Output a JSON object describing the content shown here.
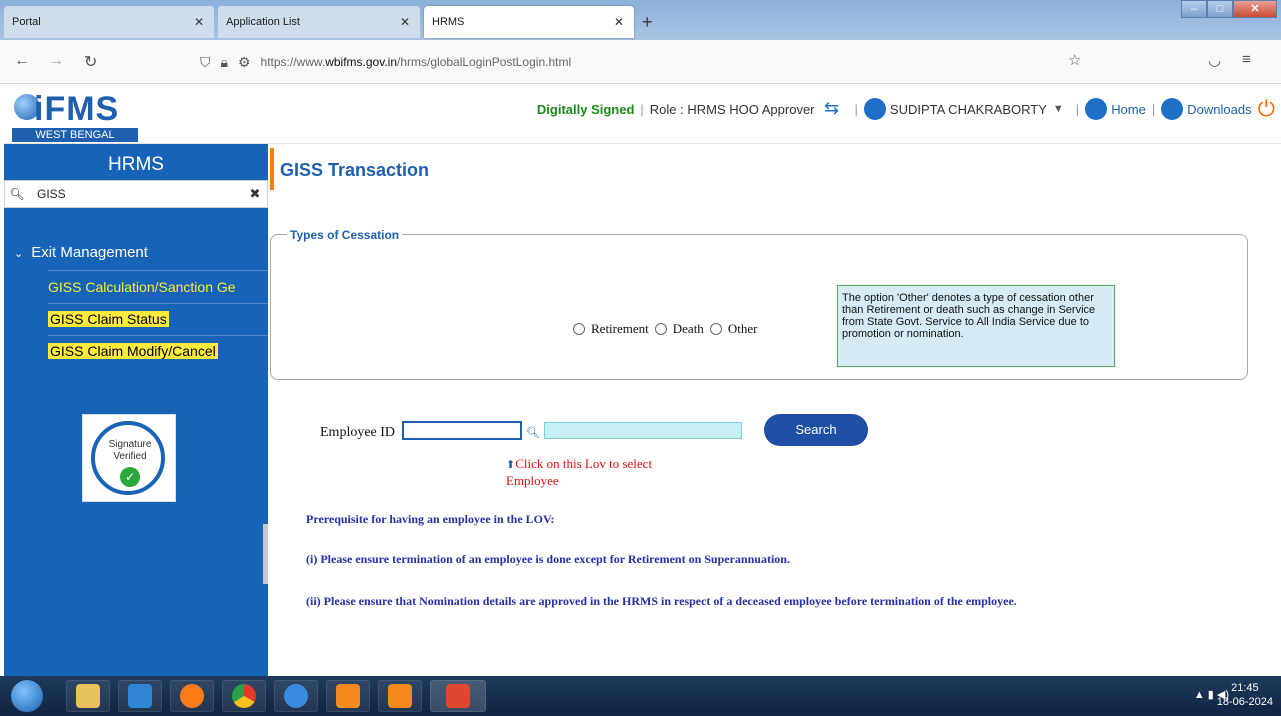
{
  "browser": {
    "tabs": [
      {
        "label": "Portal"
      },
      {
        "label": "Application List"
      },
      {
        "label": "HRMS"
      }
    ],
    "url": {
      "prefix": "https://www.",
      "domain": "wbifms.gov.in",
      "path": "/hrms/globalLoginPostLogin.html"
    }
  },
  "header": {
    "logo_text": "iFMS",
    "logo_subtitle": "WEST BENGAL",
    "digitally_signed": "Digitally Signed",
    "role": "Role : HRMS HOO Approver",
    "user": "SUDIPTA CHAKRABORTY",
    "home": "Home",
    "downloads": "Downloads"
  },
  "sidebar": {
    "title": "HRMS",
    "search_value": "GISS",
    "section": "Exit Management",
    "items": [
      {
        "label": "GISS Calculation/Sanction Ge"
      },
      {
        "label": "GISS Claim Status"
      },
      {
        "label": "GISS Claim Modify/Cancel"
      }
    ],
    "signature": {
      "line1": "Signature",
      "line2": "Verified"
    }
  },
  "main": {
    "title": "GISS Transaction",
    "cessation": {
      "legend": "Types of Cessation",
      "options": [
        "Retirement",
        "Death",
        "Other"
      ],
      "note": "The option 'Other' denotes a type of cessation other than Retirement or death such as change in Service from State Govt. Service to All India Service due to promotion or nomination."
    },
    "employee_label": "Employee ID",
    "search_button": "Search",
    "lov_hint": "Click on this Lov to select Employee",
    "requirements": [
      "Prerequisite for having an employee in the LOV:",
      "(i) Please ensure termination of an employee is done except for Retirement on Superannuation.",
      "(ii) Please ensure that Nomination details are approved in the HRMS in respect of a deceased employee before termination of the employee."
    ]
  },
  "taskbar": {
    "clock_time": "21:45",
    "clock_date": "18-06-2024"
  }
}
